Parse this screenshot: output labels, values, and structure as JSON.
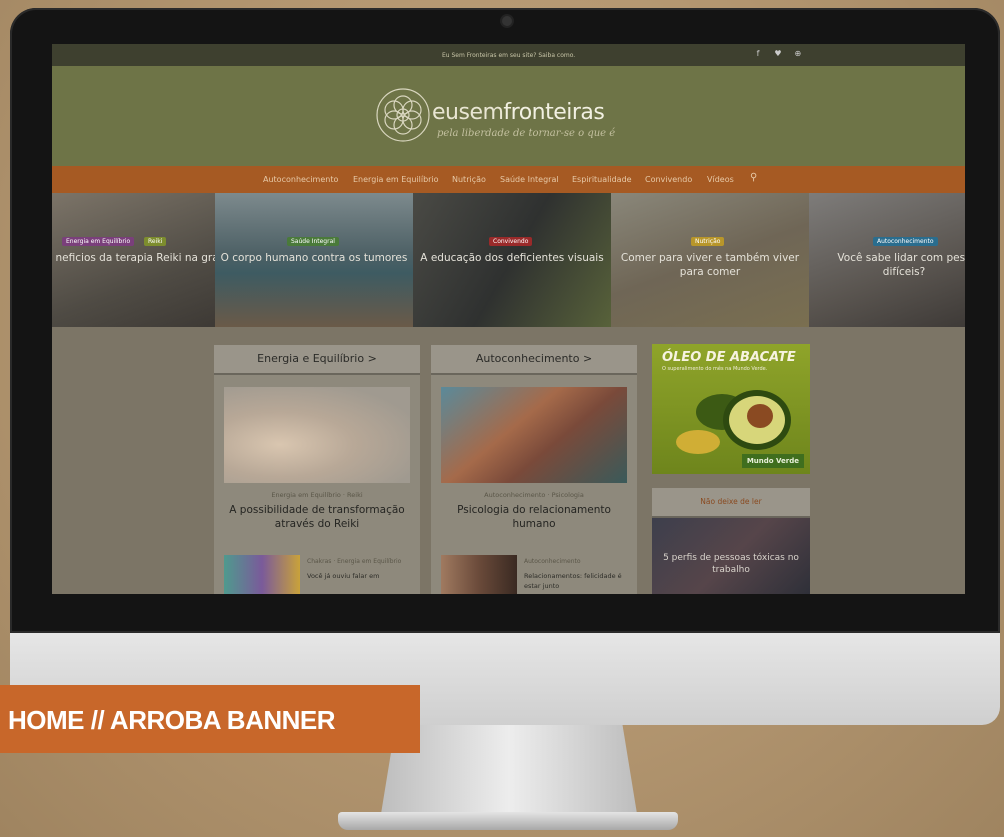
{
  "top_bar": {
    "message": "Eu Sem Fronteiras em seu site? Saiba como.",
    "social": [
      {
        "icon": "facebook-icon",
        "glyph": "f"
      },
      {
        "icon": "twitter-icon",
        "glyph": "♥"
      },
      {
        "icon": "pinterest-icon",
        "glyph": "⊕"
      }
    ]
  },
  "header": {
    "logo_prefix": "eusem",
    "logo_suffix": "fronteiras",
    "tagline": "pela liberdade de tornar-se o que é"
  },
  "nav": {
    "items": [
      "Autoconhecimento",
      "Energia em Equilíbrio",
      "Nutrição",
      "Saúde Integral",
      "Espiritualidade",
      "Convivendo",
      "Vídeos"
    ],
    "search_icon": "⚲"
  },
  "slider": [
    {
      "tags": [
        "Energia em Equilíbrio",
        "Reiki"
      ],
      "title": "neficios da terapia Reiki na gravidez"
    },
    {
      "tags": [
        "Saúde Integral"
      ],
      "title": "O corpo humano contra os tumores"
    },
    {
      "tags": [
        "Convivendo"
      ],
      "title": "A educação dos deficientes visuais"
    },
    {
      "tags": [
        "Nutrição"
      ],
      "title": "Comer para viver e também viver para comer"
    },
    {
      "tags": [
        "Autoconhecimento"
      ],
      "title": "Você sabe lidar com pess difíceis?"
    }
  ],
  "columns": [
    {
      "heading": "Energia e Equilíbrio >",
      "meta": "Energia em Equilíbrio · Reiki",
      "title": "A possibilidade de transformação através do Reiki",
      "small_meta": "Chakras · Energia em Equilíbrio",
      "small_text": "Você já ouviu falar em"
    },
    {
      "heading": "Autoconhecimento >",
      "meta": "Autoconhecimento · Psicologia",
      "title": "Psicologia do relacionamento humano",
      "small_meta": "Autoconhecimento",
      "small_text": "Relacionamentos: felicidade é estar junto"
    }
  ],
  "ad": {
    "headline": "ÓLEO DE ABACATE",
    "sub": "O superalimento do mês na Mundo Verde.",
    "brand": "Mundo Verde"
  },
  "dont_miss": {
    "heading": "Não deixe de ler",
    "title": "5 perfis de pessoas tóxicas no trabalho"
  },
  "banner_label": "HOME // ARROBA BANNER",
  "colors": {
    "nav_orange": "#a65a23",
    "header_olive": "#6e7447",
    "label_orange": "#c8672a"
  }
}
